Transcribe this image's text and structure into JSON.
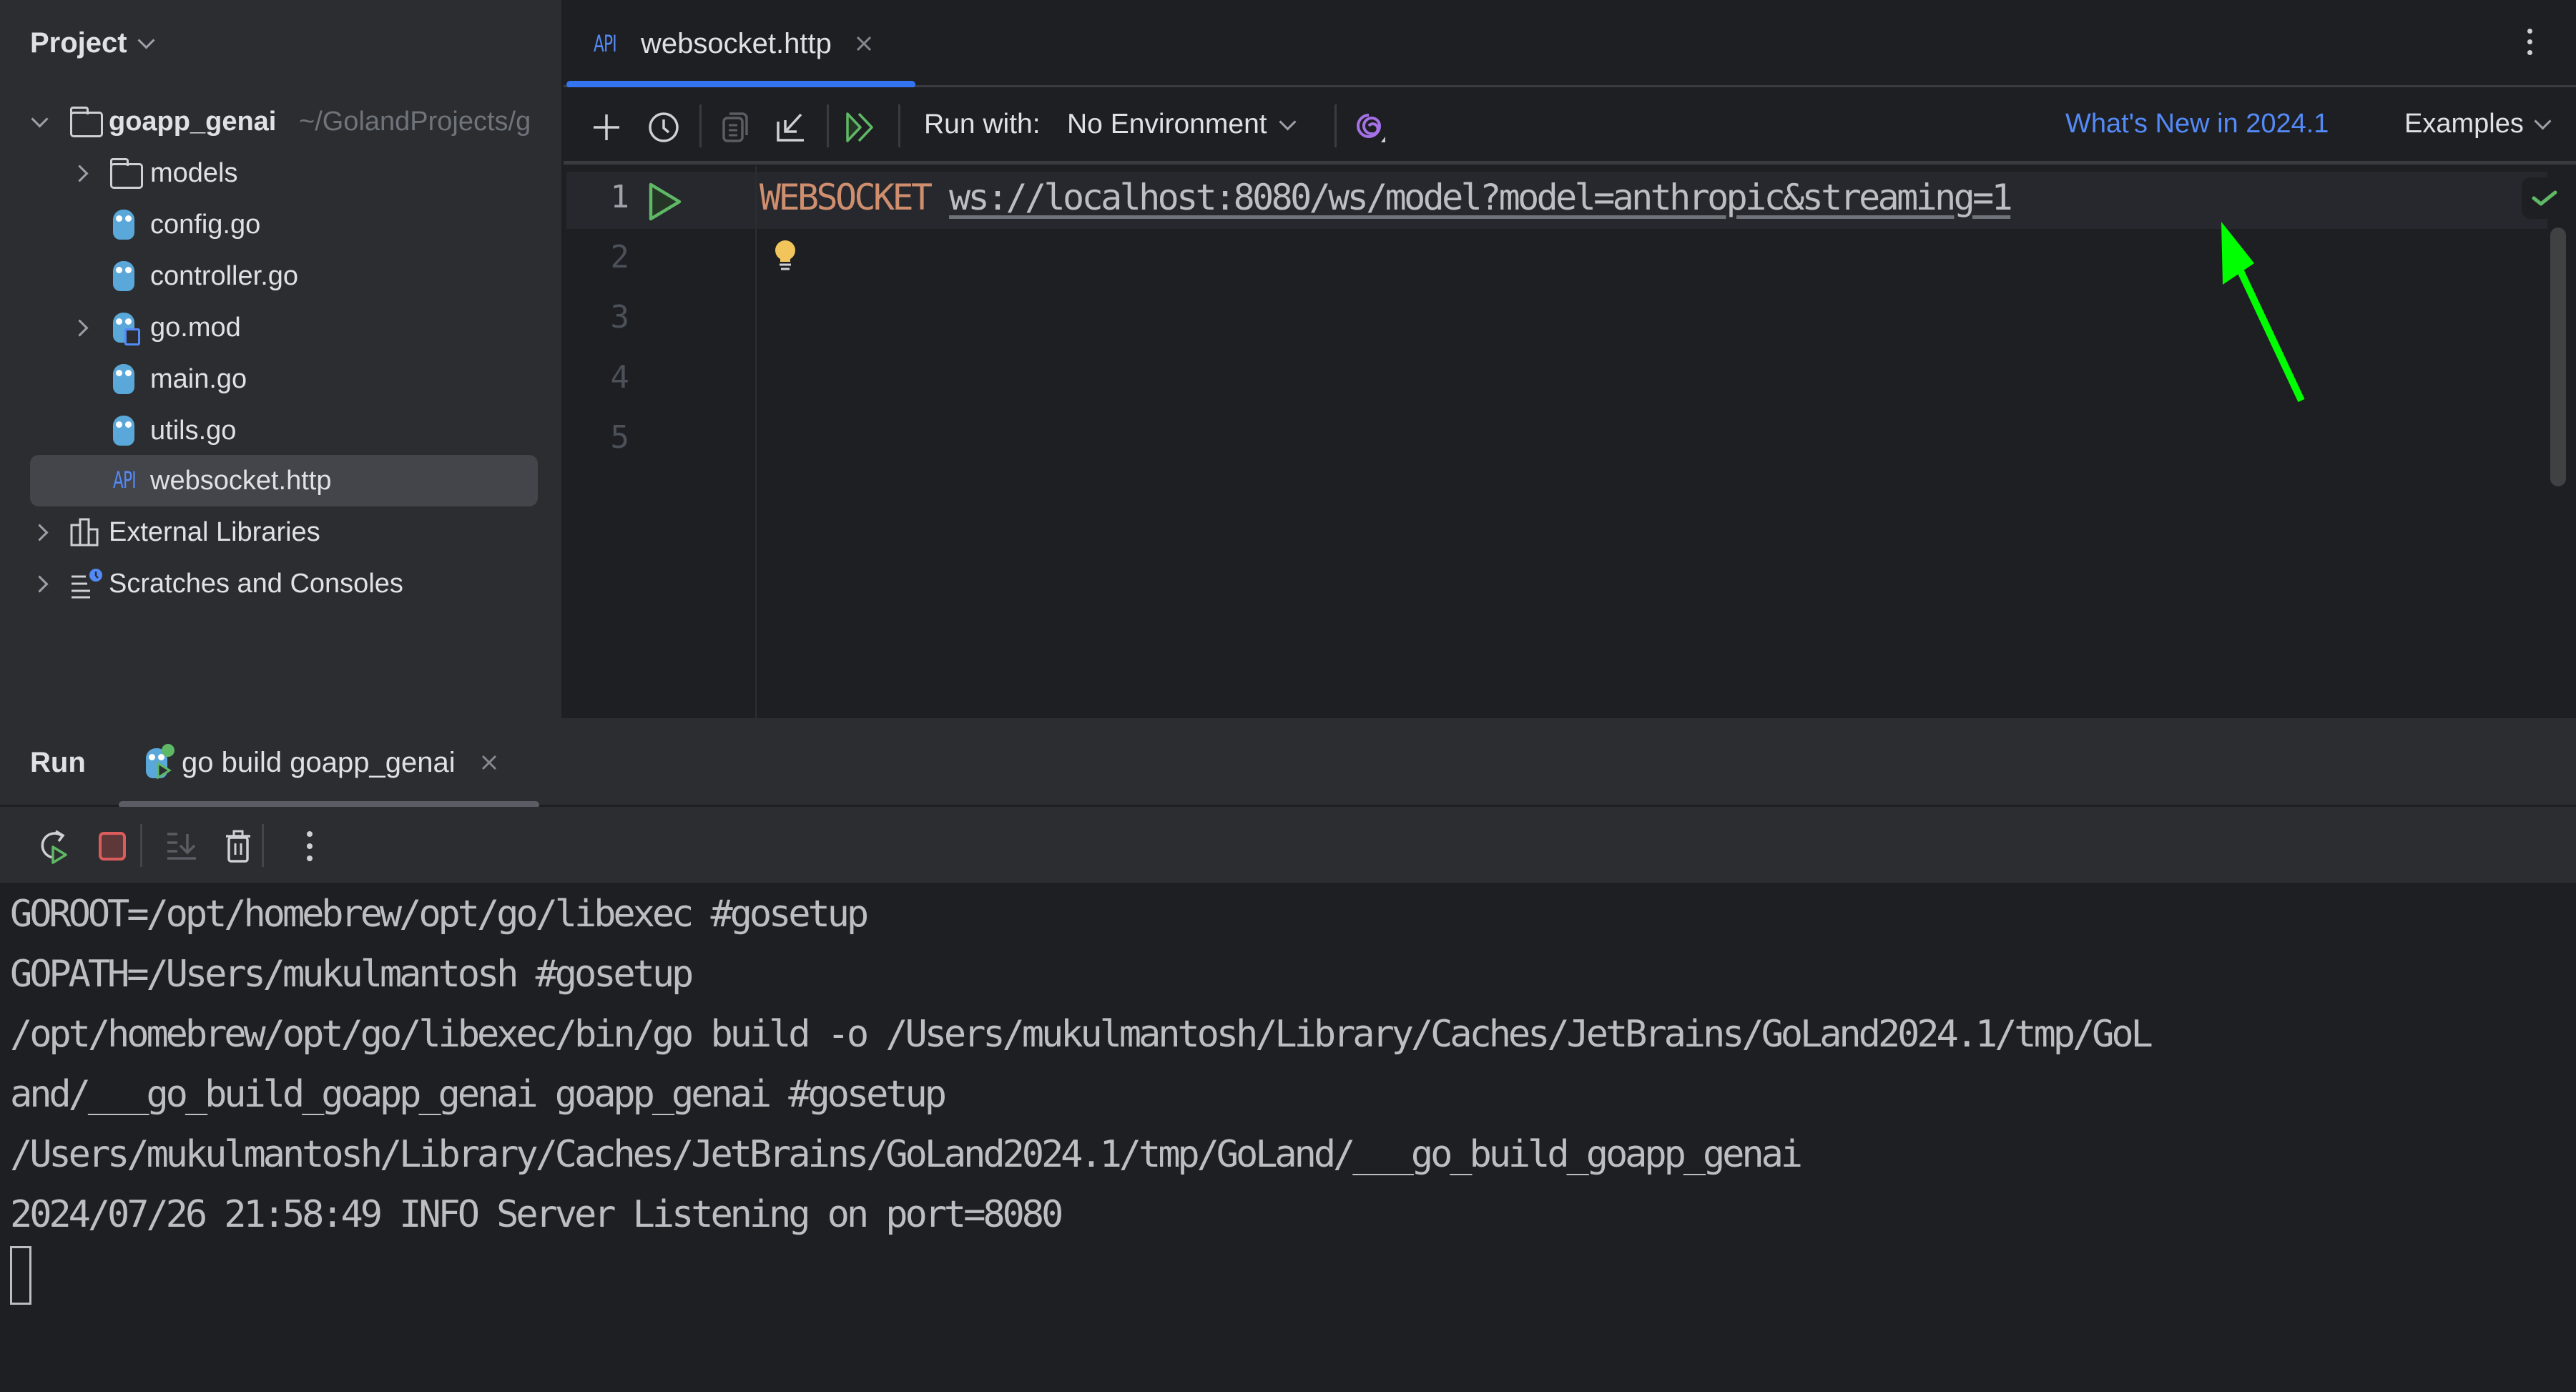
{
  "sidebar": {
    "title": "Project",
    "root": {
      "name": "goapp_genai",
      "path": "~/GolandProjects/g"
    },
    "items": [
      {
        "label": "models",
        "type": "folder",
        "expandable": true
      },
      {
        "label": "config.go",
        "type": "go-file"
      },
      {
        "label": "controller.go",
        "type": "go-file"
      },
      {
        "label": "go.mod",
        "type": "go-mod",
        "expandable": true
      },
      {
        "label": "main.go",
        "type": "go-file"
      },
      {
        "label": "utils.go",
        "type": "go-file"
      },
      {
        "label": "websocket.http",
        "type": "http-file",
        "selected": true
      }
    ],
    "external_libraries": "External Libraries",
    "scratches": "Scratches and Consoles"
  },
  "editor": {
    "tab": {
      "icon_text": "API",
      "label": "websocket.http"
    },
    "toolbar": {
      "run_with_label": "Run with:",
      "environment": "No Environment",
      "whats_new": "What's New in 2024.1",
      "examples": "Examples"
    },
    "line_numbers": [
      "1",
      "2",
      "3",
      "4",
      "5"
    ],
    "code": {
      "keyword": "WEBSOCKET",
      "url": "ws://localhost:8080/ws/model?model=anthropic&streaming=1"
    }
  },
  "run_panel": {
    "title": "Run",
    "tab_label": "go build goapp_genai",
    "console_lines": [
      "GOROOT=/opt/homebrew/opt/go/libexec #gosetup",
      "GOPATH=/Users/mukulmantosh #gosetup",
      "/opt/homebrew/opt/go/libexec/bin/go build -o /Users/mukulmantosh/Library/Caches/JetBrains/GoLand2024.1/tmp/GoL",
      "and/___go_build_goapp_genai goapp_genai #gosetup",
      "/Users/mukulmantosh/Library/Caches/JetBrains/GoLand2024.1/tmp/GoLand/___go_build_goapp_genai",
      "2024/07/26 21:58:49 INFO Server Listening on port=8080"
    ]
  },
  "colors": {
    "accent": "#3574f0",
    "keyword": "#cf8e6d",
    "link": "#548af7",
    "run_green": "#5fb865",
    "annotation_arrow": "#00ff00"
  }
}
